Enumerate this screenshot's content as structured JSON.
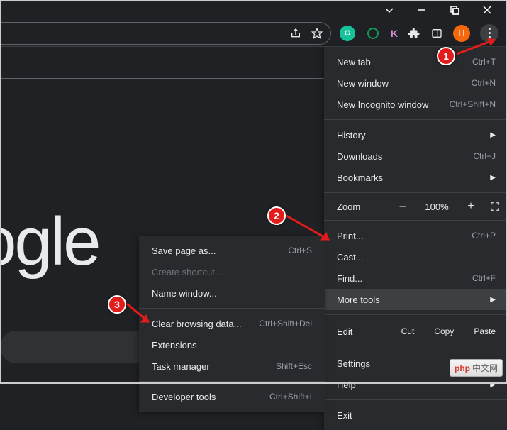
{
  "titlebar": {
    "minimize": "minimize",
    "maximize": "maximize",
    "close": "close"
  },
  "toolbar": {
    "share": "share",
    "bookmark": "bookmark",
    "avatar_letter": "H",
    "k_letter": "K"
  },
  "page": {
    "title_fragment": "ogle"
  },
  "menu": {
    "new_tab": {
      "label": "New tab",
      "shortcut": "Ctrl+T"
    },
    "new_window": {
      "label": "New window",
      "shortcut": "Ctrl+N"
    },
    "incognito": {
      "label": "New Incognito window",
      "shortcut": "Ctrl+Shift+N"
    },
    "history": {
      "label": "History"
    },
    "downloads": {
      "label": "Downloads",
      "shortcut": "Ctrl+J"
    },
    "bookmarks": {
      "label": "Bookmarks"
    },
    "zoom": {
      "label": "Zoom",
      "minus": "–",
      "value": "100%",
      "plus": "+"
    },
    "print": {
      "label": "Print...",
      "shortcut": "Ctrl+P"
    },
    "cast": {
      "label": "Cast..."
    },
    "find": {
      "label": "Find...",
      "shortcut": "Ctrl+F"
    },
    "more_tools": {
      "label": "More tools"
    },
    "edit": {
      "label": "Edit",
      "cut": "Cut",
      "copy": "Copy",
      "paste": "Paste"
    },
    "settings": {
      "label": "Settings"
    },
    "help": {
      "label": "Help"
    },
    "exit": {
      "label": "Exit"
    }
  },
  "submenu": {
    "save_page": {
      "label": "Save page as...",
      "shortcut": "Ctrl+S"
    },
    "create_shortcut": {
      "label": "Create shortcut..."
    },
    "name_window": {
      "label": "Name window..."
    },
    "clear_browsing": {
      "label": "Clear browsing data...",
      "shortcut": "Ctrl+Shift+Del"
    },
    "extensions": {
      "label": "Extensions"
    },
    "task_manager": {
      "label": "Task manager",
      "shortcut": "Shift+Esc"
    },
    "dev_tools": {
      "label": "Developer tools",
      "shortcut": "Ctrl+Shift+I"
    }
  },
  "markers": {
    "one": "1",
    "two": "2",
    "three": "3"
  },
  "watermark": {
    "brand": "php",
    "suffix": "中文网"
  }
}
